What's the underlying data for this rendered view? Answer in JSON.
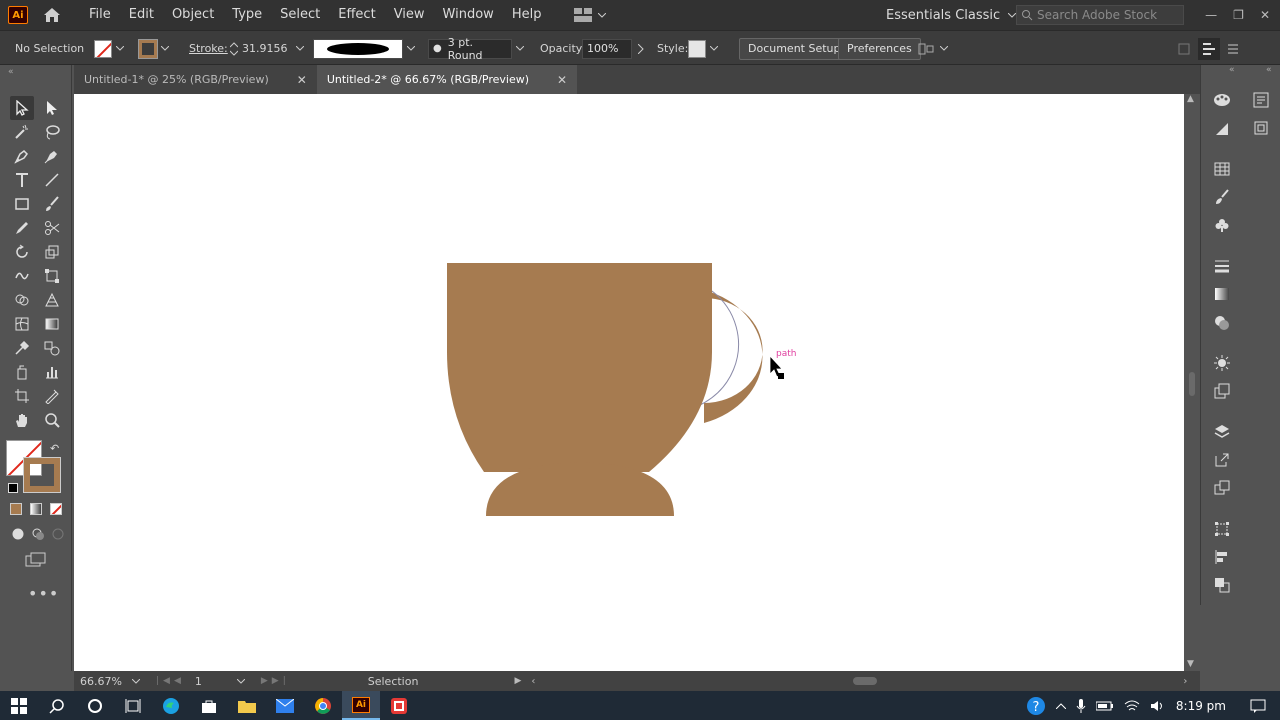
{
  "app": {
    "logo_text": "Ai"
  },
  "menu": [
    "File",
    "Edit",
    "Object",
    "Type",
    "Select",
    "Effect",
    "View",
    "Window",
    "Help"
  ],
  "workspace": {
    "label": "Essentials Classic"
  },
  "search": {
    "placeholder": "Search Adobe Stock"
  },
  "control_bar": {
    "selection_label": "No Selection",
    "stroke_label": "Stroke:",
    "stroke_value": "31.9156",
    "brush_label": "3 pt. Round",
    "opacity_label": "Opacity:",
    "opacity_value": "100%",
    "style_label": "Style:",
    "document_setup": "Document Setup",
    "preferences": "Preferences"
  },
  "tabs": [
    {
      "label": "Untitled-1* @ 25% (RGB/Preview)",
      "active": false
    },
    {
      "label": "Untitled-2* @ 66.67% (RGB/Preview)",
      "active": true
    }
  ],
  "canvas": {
    "smart_guide_label": "path",
    "fill_color": "#a67b50"
  },
  "status": {
    "zoom": "66.67%",
    "artboard": "1",
    "tool": "Selection"
  },
  "taskbar": {
    "time": "8:19 pm"
  },
  "colors": {
    "accent": "#a67b50",
    "menubar": "#323232",
    "panel": "#535353"
  }
}
